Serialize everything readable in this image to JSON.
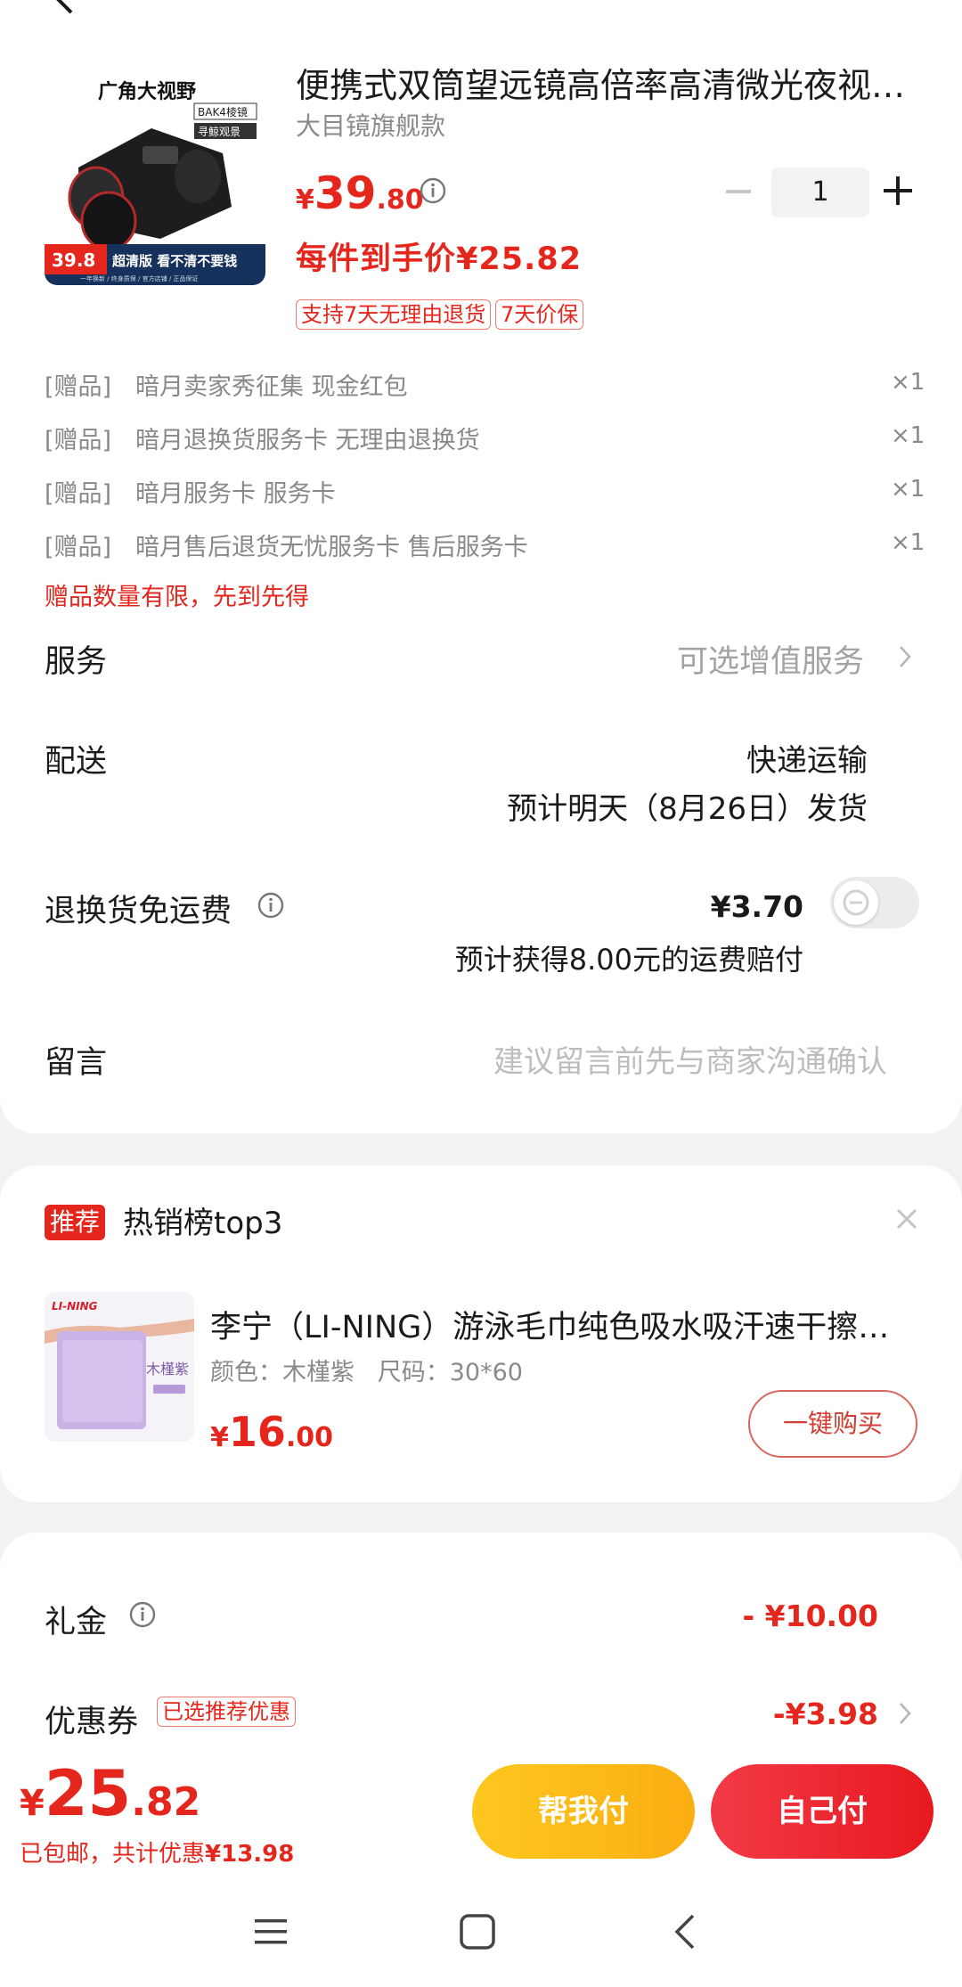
{
  "product": {
    "title": "便携式双筒望远镜高倍率高清微光夜视非…",
    "shop": "大目镜旗舰款",
    "image": {
      "headline": "广角大视野",
      "badge1": "BAK4棱镜",
      "badge2": "寻鲸观景",
      "price_tag": "39.8",
      "banner": "超清版 看不清不要钱",
      "footnote": "一年换新 / 终身质保 / 官方店铺 / 正品保证"
    },
    "price_currency": "¥",
    "price_int": "39",
    "price_dec": ".80",
    "per_piece": "每件到手价¥25.82",
    "tags": [
      "支持7天无理由退货",
      "7天价保"
    ],
    "quantity": "1"
  },
  "gifts": [
    {
      "tag": "[赠品]",
      "name": "暗月卖家秀征集 现金红包",
      "count": "×1"
    },
    {
      "tag": "[赠品]",
      "name": "暗月退换货服务卡 无理由退换货",
      "count": "×1"
    },
    {
      "tag": "[赠品]",
      "name": "暗月服务卡 服务卡",
      "count": "×1"
    },
    {
      "tag": "[赠品]",
      "name": "暗月售后退货无忧服务卡 售后服务卡",
      "count": "×1"
    }
  ],
  "gift_note": "赠品数量有限，先到先得",
  "service": {
    "label": "服务",
    "value": "可选增值服务"
  },
  "delivery": {
    "label": "配送",
    "method": "快递运输",
    "estimate": "预计明天（8月26日）发货"
  },
  "return_shipping": {
    "label": "退换货免运费",
    "price": "¥3.70",
    "note": "预计获得8.00元的运费赔付",
    "enabled": false
  },
  "message": {
    "label": "留言",
    "placeholder": "建议留言前先与商家沟通确认"
  },
  "recommend": {
    "badge": "推荐",
    "title": "热销榜top3",
    "name": "李宁（LI-NING）游泳毛巾纯色吸水吸汗速干擦…",
    "attrs": "颜色：木槿紫   尺码：30*60",
    "image_brand": "LI-NING",
    "image_label": "木槿紫",
    "price_currency": "¥",
    "price_int": "16",
    "price_dec": ".00",
    "buy_label": "一键购买"
  },
  "discounts": {
    "gift_money": {
      "label": "礼金",
      "value": "- ¥10.00"
    },
    "coupon": {
      "label": "优惠券",
      "tag": "已选推荐优惠",
      "value": "-¥3.98"
    }
  },
  "bottom_bar": {
    "total_currency": "¥",
    "total_int": "25",
    "total_dec": ".82",
    "note_prefix": "已包邮，共计优惠",
    "note_amount": "¥13.98",
    "help_pay": "帮我付",
    "self_pay": "自己付"
  },
  "colors": {
    "accent": "#e4261d",
    "help_btn": "#fdbb18",
    "self_btn": "#ee2a33"
  }
}
